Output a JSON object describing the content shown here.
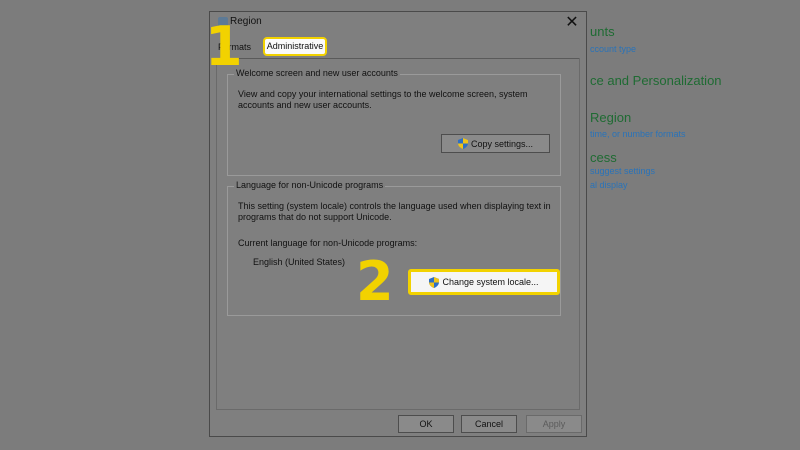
{
  "background": {
    "items": [
      {
        "text": "unts",
        "kind": "heading"
      },
      {
        "text": "ccount type",
        "kind": "link"
      },
      {
        "text": "ce and Personalization",
        "kind": "heading"
      },
      {
        "text": "Region",
        "kind": "heading"
      },
      {
        "text": "time, or number formats",
        "kind": "link"
      },
      {
        "text": "cess",
        "kind": "heading"
      },
      {
        "text": "suggest settings",
        "kind": "link"
      },
      {
        "text": "al display",
        "kind": "link"
      }
    ]
  },
  "dialog": {
    "title": "Region",
    "close_glyph": "✕",
    "tabs": [
      {
        "label": "Formats",
        "selected": false
      },
      {
        "label": "Administrative",
        "selected": true
      }
    ],
    "welcome_group": {
      "title": "Welcome screen and new user accounts",
      "description": "View and copy your international settings to the welcome screen, system accounts and new user accounts.",
      "button_label": "Copy settings..."
    },
    "unicode_group": {
      "title": "Language for non-Unicode programs",
      "description": "This setting (system locale) controls the language used when displaying text in programs that do not support Unicode.",
      "current_label": "Current language for non-Unicode programs:",
      "current_value": "English (United States)",
      "button_label": "Change system locale..."
    },
    "footer": {
      "ok_label": "OK",
      "cancel_label": "Cancel",
      "apply_label": "Apply"
    }
  },
  "callouts": {
    "step1": "1",
    "step2": "2"
  },
  "colors": {
    "highlight": "#f2d200",
    "shield_blue": "#2f6fc4",
    "shield_yellow": "#f0c419"
  },
  "icons": {
    "shield": "uac-shield-icon",
    "close": "close-icon",
    "app": "region-app-icon"
  }
}
